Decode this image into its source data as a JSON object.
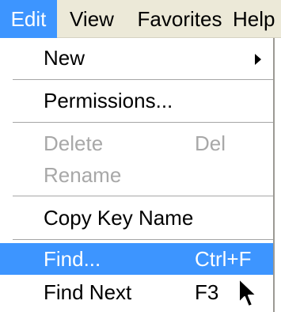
{
  "menubar": {
    "items": [
      {
        "label": "Edit",
        "active": true
      },
      {
        "label": "View",
        "active": false
      },
      {
        "label": "Favorites",
        "active": false
      },
      {
        "label": "Help",
        "active": false
      }
    ]
  },
  "edit_menu": {
    "new": {
      "label": "New",
      "has_submenu": true
    },
    "permissions": {
      "label": "Permissions..."
    },
    "delete": {
      "label": "Delete",
      "shortcut": "Del",
      "enabled": false
    },
    "rename": {
      "label": "Rename",
      "enabled": false
    },
    "copy_key_name": {
      "label": "Copy Key Name"
    },
    "find": {
      "label": "Find...",
      "shortcut": "Ctrl+F",
      "highlighted": true
    },
    "find_next": {
      "label": "Find Next",
      "shortcut": "F3"
    }
  },
  "colors": {
    "highlight": "#3d95ff",
    "disabled_text": "#a8a8a8",
    "menubar_bg": "#ece9d8"
  },
  "icons": {
    "submenu_arrow": "submenu-arrow-icon",
    "pointer": "mouse-pointer-icon"
  }
}
